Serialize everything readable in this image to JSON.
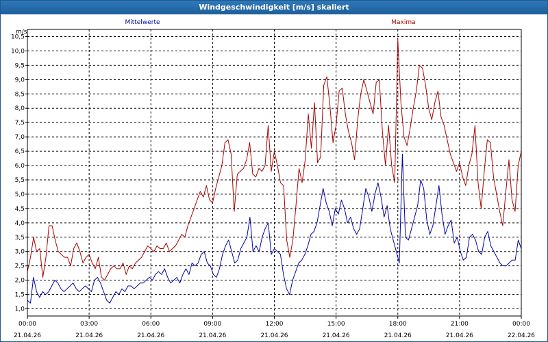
{
  "window": {
    "title": "Windgeschwindigkeit [m/s] skaliert"
  },
  "colors": {
    "mean": "#0000aa",
    "max": "#aa0000",
    "grid": "#000000",
    "axis": "#000000"
  },
  "chart_data": {
    "type": "line",
    "title": "Windgeschwindigkeit [m/s] skaliert",
    "ylabel": "m/s",
    "xlabel": "",
    "ylim": [
      0.75,
      10.75
    ],
    "xlim": [
      0,
      24
    ],
    "grid": true,
    "legend": "top",
    "y_ticks": [
      "1,0",
      "1,5",
      "2,0",
      "2,5",
      "3,0",
      "3,5",
      "4,0",
      "4,5",
      "5,0",
      "5,5",
      "6,0",
      "6,5",
      "7,0",
      "7,5",
      "8,0",
      "8,5",
      "9,0",
      "9,5",
      "10,0",
      "10,5"
    ],
    "x_ticks": [
      {
        "time": "00:00",
        "date": "21.04.26"
      },
      {
        "time": "03:00",
        "date": "21.04.26"
      },
      {
        "time": "06:00",
        "date": "21.04.26"
      },
      {
        "time": "09:00",
        "date": "21.04.26"
      },
      {
        "time": "12:00",
        "date": "21.04.26"
      },
      {
        "time": "15:00",
        "date": "21.04.26"
      },
      {
        "time": "18:00",
        "date": "21.04.26"
      },
      {
        "time": "21:00",
        "date": "21.04.26"
      },
      {
        "time": "00:00",
        "date": "22.04.26"
      }
    ],
    "series": [
      {
        "name": "Mittelwerte",
        "color": "#0000aa",
        "values": [
          1.3,
          1.2,
          2.1,
          1.6,
          1.4,
          1.6,
          1.5,
          1.6,
          1.8,
          2.0,
          1.9,
          1.7,
          1.6,
          1.7,
          1.8,
          1.9,
          1.7,
          1.6,
          1.7,
          1.8,
          1.7,
          1.6,
          2.0,
          2.1,
          1.9,
          1.6,
          1.3,
          1.2,
          1.4,
          1.6,
          1.5,
          1.7,
          1.6,
          1.8,
          1.8,
          1.7,
          1.8,
          1.9,
          1.9,
          2.0,
          2.1,
          2.0,
          2.2,
          2.3,
          2.2,
          2.4,
          2.1,
          1.9,
          2.0,
          2.1,
          1.9,
          2.2,
          2.4,
          2.2,
          2.6,
          2.5,
          2.6,
          2.9,
          3.0,
          2.6,
          2.5,
          2.2,
          2.1,
          2.4,
          2.9,
          3.2,
          3.4,
          3.0,
          2.6,
          2.7,
          3.1,
          3.3,
          3.5,
          4.2,
          3.0,
          3.2,
          3.0,
          3.5,
          3.8,
          4.0,
          2.9,
          3.1,
          3.0,
          2.9,
          2.2,
          1.7,
          1.5,
          2.0,
          2.3,
          2.6,
          2.7,
          2.9,
          3.2,
          3.6,
          3.7,
          4.0,
          4.6,
          5.2,
          4.7,
          4.4,
          3.9,
          4.5,
          4.3,
          4.8,
          4.5,
          4.0,
          4.2,
          3.8,
          3.6,
          3.8,
          4.5,
          5.2,
          4.9,
          4.4,
          5.0,
          5.4,
          4.9,
          4.2,
          4.6,
          3.8,
          3.4,
          3.0,
          2.6,
          6.4,
          3.5,
          3.4,
          3.8,
          4.2,
          4.6,
          5.5,
          5.2,
          4.1,
          3.6,
          3.9,
          4.6,
          5.3,
          4.3,
          3.6,
          3.9,
          4.1,
          3.3,
          3.5,
          3.0,
          2.7,
          2.8,
          3.5,
          3.6,
          3.4,
          3.0,
          2.9,
          3.5,
          3.7,
          3.2,
          3.0,
          2.8,
          2.6,
          2.5,
          2.5,
          2.6,
          2.7,
          2.7,
          3.4,
          3.1
        ]
      },
      {
        "name": "Maxima",
        "color": "#aa0000",
        "values": [
          2.3,
          2.8,
          3.5,
          3.0,
          3.1,
          2.1,
          2.8,
          3.9,
          3.9,
          3.4,
          3.0,
          2.9,
          2.8,
          2.8,
          2.5,
          3.1,
          3.3,
          3.0,
          2.6,
          2.8,
          2.9,
          2.6,
          2.4,
          2.8,
          2.1,
          2.0,
          2.2,
          2.4,
          2.5,
          2.4,
          2.4,
          2.6,
          2.2,
          2.5,
          2.4,
          2.6,
          2.7,
          2.8,
          3.0,
          3.2,
          3.1,
          3.0,
          3.2,
          3.1,
          3.1,
          3.3,
          3.0,
          3.1,
          3.2,
          3.4,
          3.6,
          3.5,
          3.9,
          4.2,
          4.5,
          4.8,
          5.1,
          4.9,
          5.3,
          4.8,
          4.7,
          5.2,
          5.6,
          6.0,
          6.8,
          6.9,
          6.4,
          4.4,
          5.7,
          5.8,
          5.9,
          6.2,
          6.8,
          5.7,
          5.6,
          5.9,
          5.8,
          6.0,
          7.4,
          5.8,
          6.5,
          6.0,
          5.4,
          5.3,
          3.4,
          2.8,
          3.4,
          4.6,
          5.9,
          5.4,
          6.2,
          7.8,
          6.6,
          8.2,
          6.1,
          6.3,
          8.8,
          9.1,
          8.1,
          6.8,
          7.4,
          8.6,
          8.7,
          7.8,
          7.2,
          6.8,
          6.2,
          7.6,
          8.5,
          9.0,
          8.6,
          8.2,
          7.8,
          8.9,
          9.0,
          7.2,
          6.0,
          7.4,
          6.0,
          5.4,
          10.4,
          8.2,
          7.0,
          6.7,
          7.3,
          8.0,
          8.6,
          9.5,
          9.4,
          8.8,
          8.0,
          7.6,
          8.2,
          8.6,
          7.7,
          7.4,
          6.9,
          6.4,
          6.1,
          5.8,
          6.1,
          5.6,
          5.3,
          6.0,
          6.4,
          7.4,
          5.4,
          4.5,
          5.8,
          6.9,
          6.8,
          5.6,
          5.0,
          4.4,
          3.9,
          5.1,
          6.2,
          4.8,
          4.4,
          6.0,
          6.5
        ]
      }
    ]
  }
}
